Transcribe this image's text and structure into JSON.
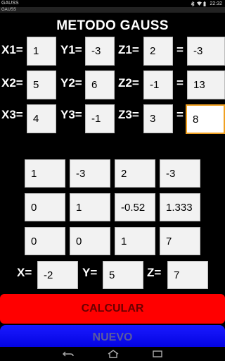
{
  "status_bar": {
    "app_name": "GAUSS",
    "time": "22:32"
  },
  "title_bar": {
    "label": "GAUSS"
  },
  "app_title": "METODO GAUSS",
  "equations": [
    {
      "x_label": "X1=",
      "x": "1",
      "y_label": "Y1=",
      "y": "-3",
      "z_label": "Z1=",
      "z": "2",
      "eq": "=",
      "r": "-3"
    },
    {
      "x_label": "X2=",
      "x": "5",
      "y_label": "Y2=",
      "y": "6",
      "z_label": "Z2=",
      "z": "-1",
      "eq": "=",
      "r": "13"
    },
    {
      "x_label": "X3=",
      "x": "4",
      "y_label": "Y3=",
      "y": "-1",
      "z_label": "Z3=",
      "z": "3",
      "eq": "=",
      "r": "8"
    }
  ],
  "matrix": [
    [
      "1",
      "-3",
      "2",
      "-3"
    ],
    [
      "0",
      "1",
      "-0.52",
      "1.333"
    ],
    [
      "0",
      "0",
      "1",
      "7"
    ]
  ],
  "result": {
    "x_label": "X=",
    "x": "-2",
    "y_label": "Y=",
    "y": "5",
    "z_label": "Z=",
    "z": "7"
  },
  "buttons": {
    "calc": "CALCULAR",
    "new": "NUEVO"
  }
}
